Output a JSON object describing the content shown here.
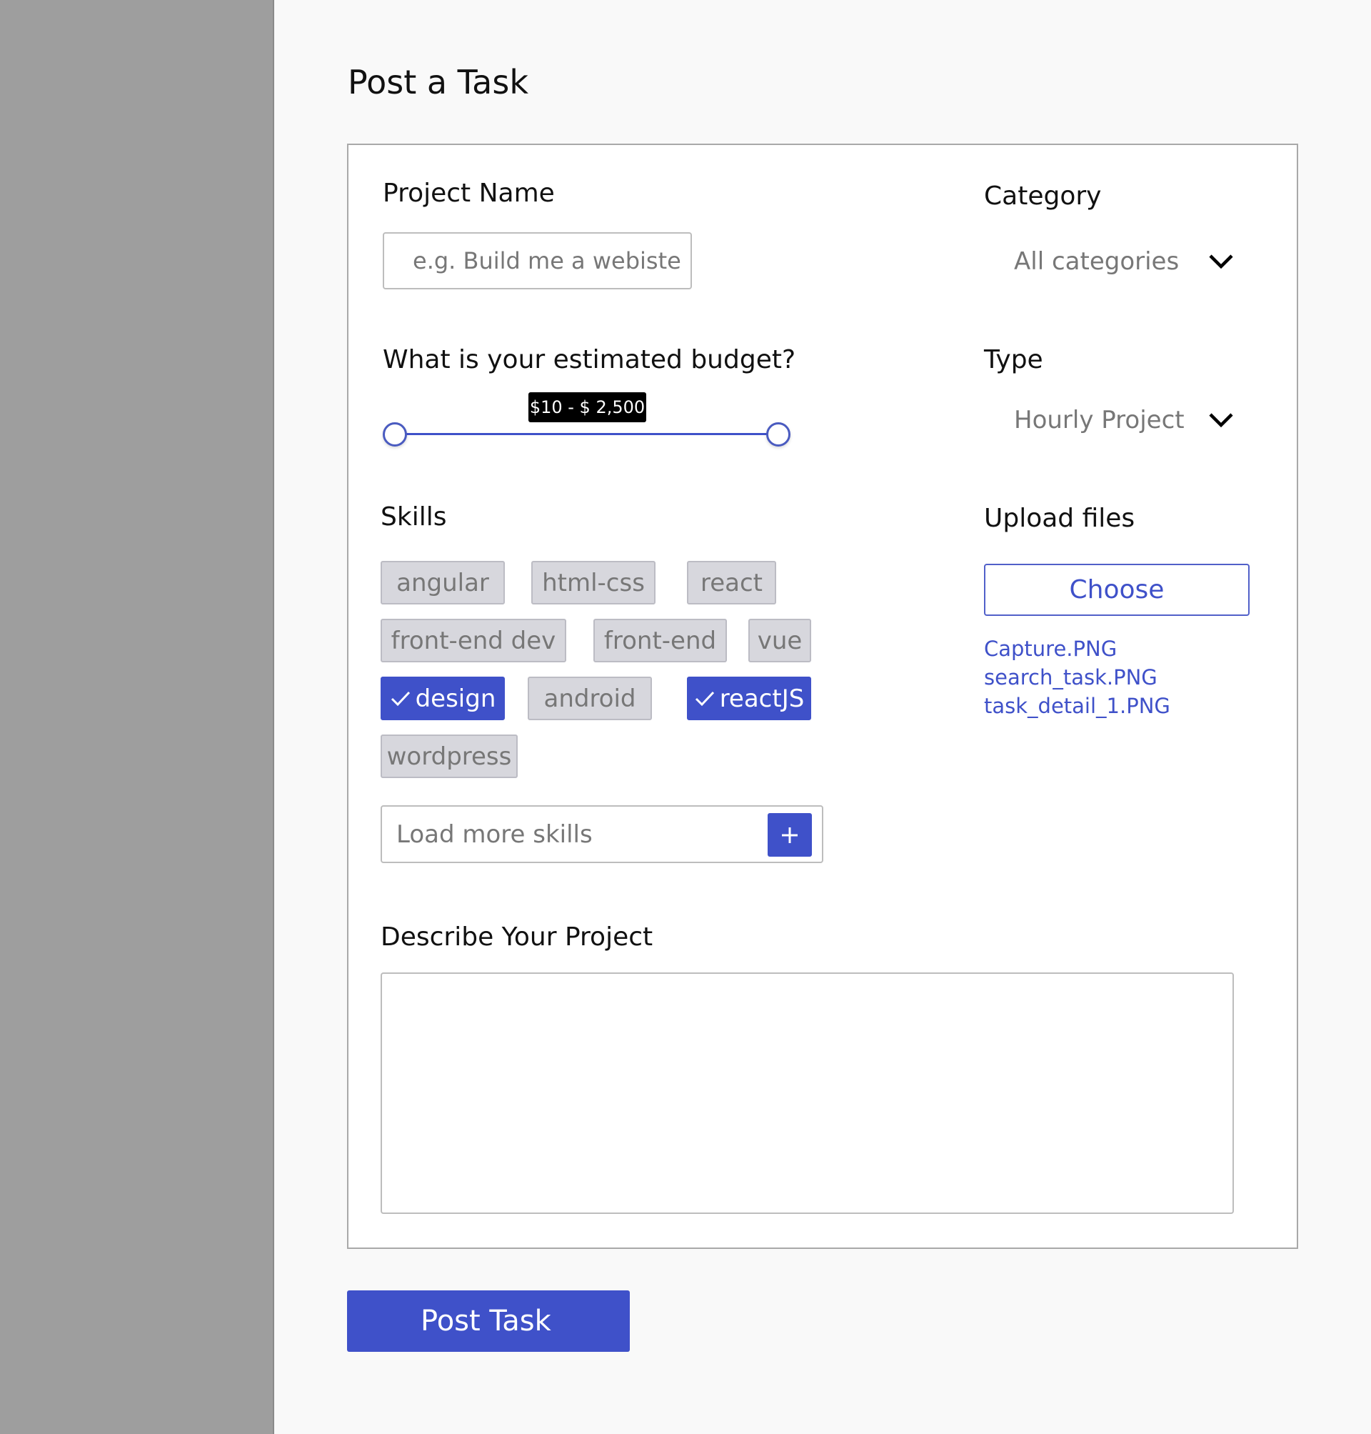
{
  "page": {
    "title": "Post a Task"
  },
  "project_name": {
    "label": "Project Name",
    "placeholder": "e.g. Build me a webiste"
  },
  "budget": {
    "label": "What is your estimated budget?",
    "range_label": "$10 - $ 2,500"
  },
  "skills": {
    "label": "Skills",
    "items": [
      {
        "label": "angular",
        "selected": false
      },
      {
        "label": "html-css",
        "selected": false
      },
      {
        "label": "react",
        "selected": false
      },
      {
        "label": "front-end dev",
        "selected": false
      },
      {
        "label": "front-end",
        "selected": false
      },
      {
        "label": "vue",
        "selected": false
      },
      {
        "label": "design",
        "selected": true
      },
      {
        "label": "android",
        "selected": false
      },
      {
        "label": "reactJS",
        "selected": true
      },
      {
        "label": "wordpress",
        "selected": false
      }
    ],
    "load_more_placeholder": "Load more skills",
    "add_icon": "plus-icon"
  },
  "description": {
    "label": "Describe Your Project",
    "value": ""
  },
  "category": {
    "label": "Category",
    "value": "All categories",
    "icon": "chevron-down-icon"
  },
  "type": {
    "label": "Type",
    "value": "Hourly Project",
    "icon": "chevron-down-icon"
  },
  "upload": {
    "label": "Upload files",
    "button_label": "Choose",
    "files": [
      "Capture.PNG",
      "search_task.PNG",
      "task_detail_1.PNG"
    ]
  },
  "actions": {
    "post_label": "Post Task"
  },
  "colors": {
    "accent": "#3f51c9",
    "sidebar": "#9e9e9e",
    "chip_bg": "#d7d7dd",
    "page_bg": "#f9f9f9"
  }
}
